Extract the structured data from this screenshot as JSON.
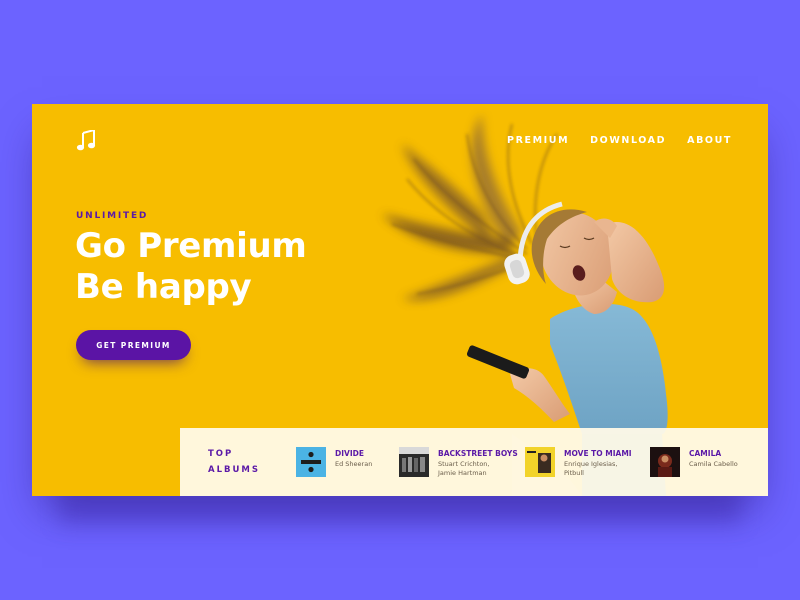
{
  "nav": {
    "items": [
      {
        "label": "PREMIUM"
      },
      {
        "label": "DOWNLOAD"
      },
      {
        "label": "ABOUT"
      }
    ]
  },
  "hero": {
    "eyebrow": "UNLIMITED",
    "headline_line1": "Go Premium",
    "headline_line2": "Be happy",
    "cta_label": "GET PREMIUM"
  },
  "top_albums": {
    "title_line1": "TOP",
    "title_line2": "ALBUMS",
    "items": [
      {
        "title": "DIVIDE",
        "artist_line1": "Ed Sheeran",
        "artist_line2": ""
      },
      {
        "title": "BACKSTREET BOYS",
        "artist_line1": "Stuart Crichton,",
        "artist_line2": "Jamie Hartman"
      },
      {
        "title": "MOVE TO MIAMI",
        "artist_line1": "Enrique Iglesias,",
        "artist_line2": "Pitbull"
      },
      {
        "title": "CAMILA",
        "artist_line1": "Camila Cabello",
        "artist_line2": ""
      }
    ]
  },
  "colors": {
    "page_background": "#6c63ff",
    "card_background": "#f7bd00",
    "accent_purple": "#5b14a5",
    "albums_bar": "#fffae8"
  },
  "icons": {
    "logo": "music-note-icon"
  }
}
